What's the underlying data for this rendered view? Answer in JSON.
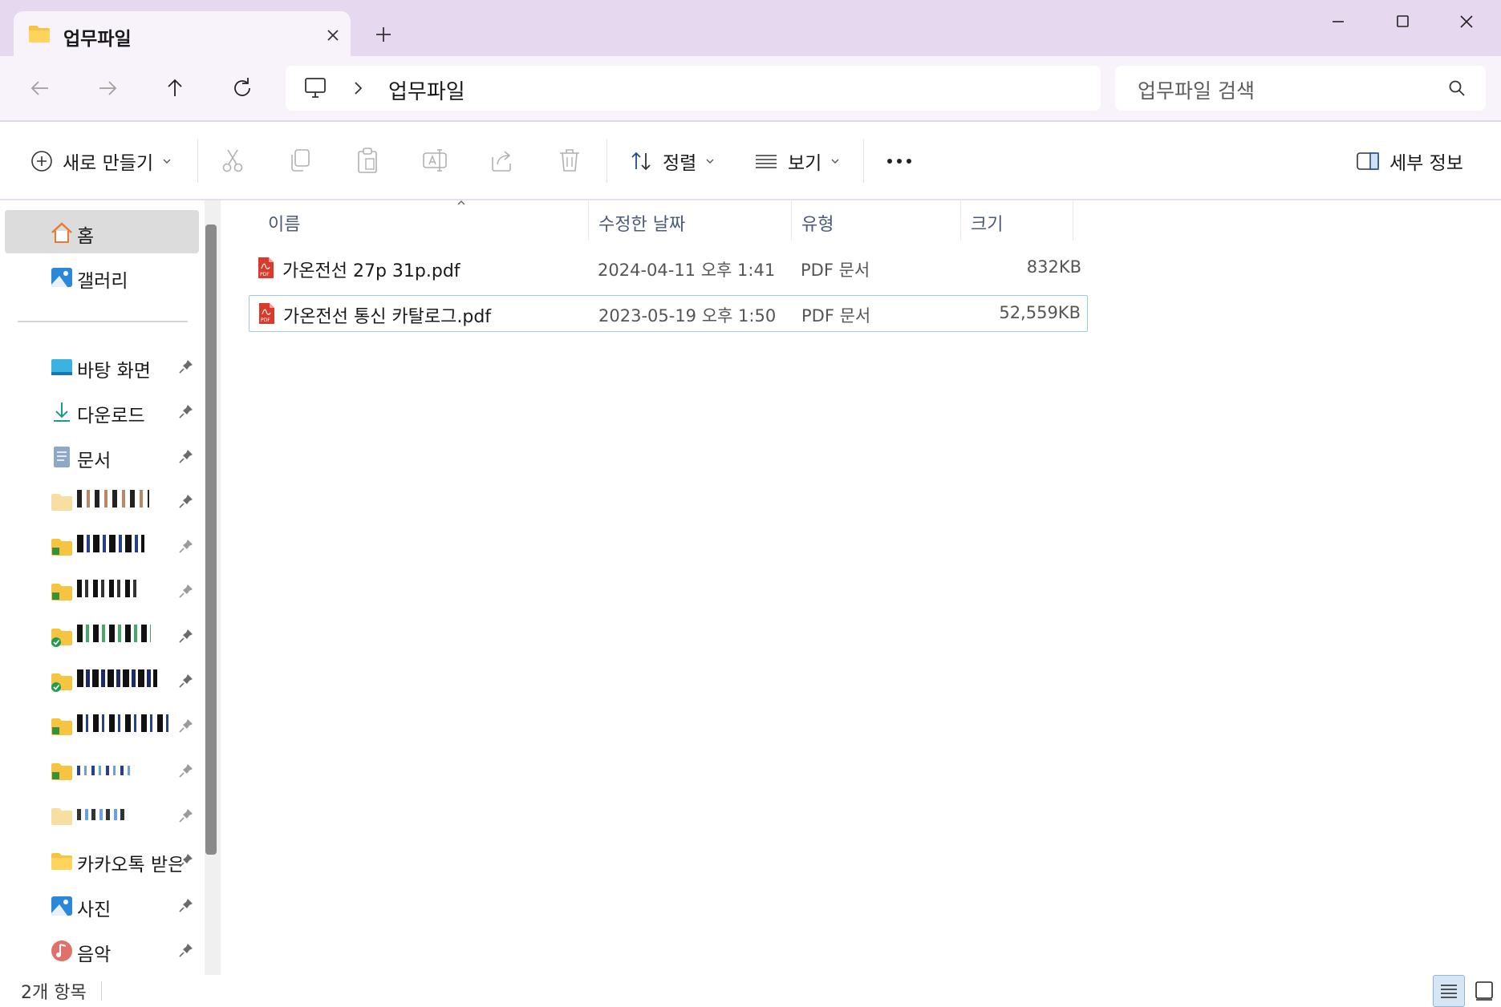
{
  "window": {
    "tab_title": "업무파일",
    "controls": [
      "minimize",
      "maximize",
      "close"
    ]
  },
  "nav": {
    "address": "업무파일",
    "search_placeholder": "업무파일 검색"
  },
  "commandbar": {
    "new_label": "새로 만들기",
    "sort_label": "정렬",
    "view_label": "보기",
    "details_label": "세부 정보"
  },
  "sidebar": {
    "home": "홈",
    "gallery": "갤러리",
    "pinned": [
      {
        "label": "바탕 화면",
        "icon": "desktop-icon"
      },
      {
        "label": "다운로드",
        "icon": "download-icon"
      },
      {
        "label": "문서",
        "icon": "document-icon"
      },
      {
        "label": "",
        "icon": "folder-icon"
      },
      {
        "label": "",
        "icon": "folder-icon"
      },
      {
        "label": "",
        "icon": "folder-icon"
      },
      {
        "label": "",
        "icon": "folder-synced-icon"
      },
      {
        "label": "",
        "icon": "folder-synced-icon"
      },
      {
        "label": "",
        "icon": "folder-icon"
      },
      {
        "label": "",
        "icon": "folder-icon"
      },
      {
        "label": "",
        "icon": "folder-icon"
      },
      {
        "label": "카카오톡 받은",
        "icon": "folder-icon"
      },
      {
        "label": "사진",
        "icon": "pictures-icon"
      },
      {
        "label": "음악",
        "icon": "music-icon"
      }
    ]
  },
  "filelist": {
    "columns": {
      "name": "이름",
      "date": "수정한 날짜",
      "type": "유형",
      "size": "크기"
    },
    "rows": [
      {
        "name": "가온전선 27p 31p.pdf",
        "date": "2024-04-11 오후 1:41",
        "type": "PDF 문서",
        "size": "832KB"
      },
      {
        "name": "가온전선 통신 카탈로그.pdf",
        "date": "2023-05-19 오후 1:50",
        "type": "PDF 문서",
        "size": "52,559KB"
      }
    ]
  },
  "status": {
    "count": "2개 항목"
  },
  "colors": {
    "titlebar": "#e6d9ef",
    "navbar": "#f8f3fb",
    "selection_border": "#9ccbe8",
    "pdf_red": "#d93a2b",
    "folder_yellow": "#f5c542"
  }
}
